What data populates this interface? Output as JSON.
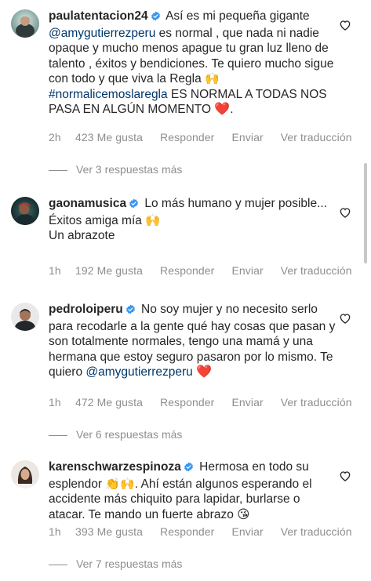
{
  "comments": [
    {
      "username": "paulatentacion24",
      "text_parts": [
        "Así es mi pequeña gigante ",
        "@amygutierrezperu",
        " es normal , que nada ni nadie opaque y mucho menos apague tu gran luz lleno de talento , éxitos y bendiciones. Te quiero mucho sigue con todo y que viva la Regla ",
        "🙌",
        " ",
        "#normalicemoslaregla",
        " ES NORMAL A TODAS NOS PASA EN ALGÚN MOMENTO ",
        "❤️",
        "."
      ],
      "time": "2h",
      "likes": "423 Me gusta",
      "reply": "Responder",
      "send": "Enviar",
      "translate": "Ver traducción",
      "more_replies": "Ver 3 respuestas más"
    },
    {
      "username": "gaonamusica",
      "lines": [
        "Lo más humano y mujer posible...",
        "Éxitos amiga mía 🙌",
        "Un abrazote"
      ],
      "time": "1h",
      "likes": "192 Me gusta",
      "reply": "Responder",
      "send": "Enviar",
      "translate": "Ver traducción"
    },
    {
      "username": "pedroloiperu",
      "text_parts": [
        "No soy mujer y no necesito serlo para recodarle a la gente qué hay cosas que pasan y son totalmente normales, tengo una mamá y una hermana que estoy seguro pasaron por lo mismo. Te quiero ",
        "@amygutierrezperu",
        " ",
        "❤️"
      ],
      "time": "1h",
      "likes": "472 Me gusta",
      "reply": "Responder",
      "send": "Enviar",
      "translate": "Ver traducción",
      "more_replies": "Ver 6 respuestas más"
    },
    {
      "username": "karenschwarzespinoza",
      "text_parts": [
        "Hermosa en todo su esplendor ",
        "👏🙌",
        ". Ahí están algunos esperando el accidente más chiquito para lapidar, burlarse o atacar. Te mando un fuerte abrazo ",
        "😘"
      ],
      "time": "1h",
      "likes": "393 Me gusta",
      "reply": "Responder",
      "send": "Enviar",
      "translate": "Ver traducción",
      "more_replies": "Ver 7 respuestas más"
    }
  ],
  "icons": {
    "like": "heart-outline-icon",
    "verified": "verified-badge-icon"
  },
  "colors": {
    "verified": "#3897f0",
    "mention": "#00376b",
    "secondary_text": "#8e8e8e",
    "heart": "#ed4956"
  }
}
